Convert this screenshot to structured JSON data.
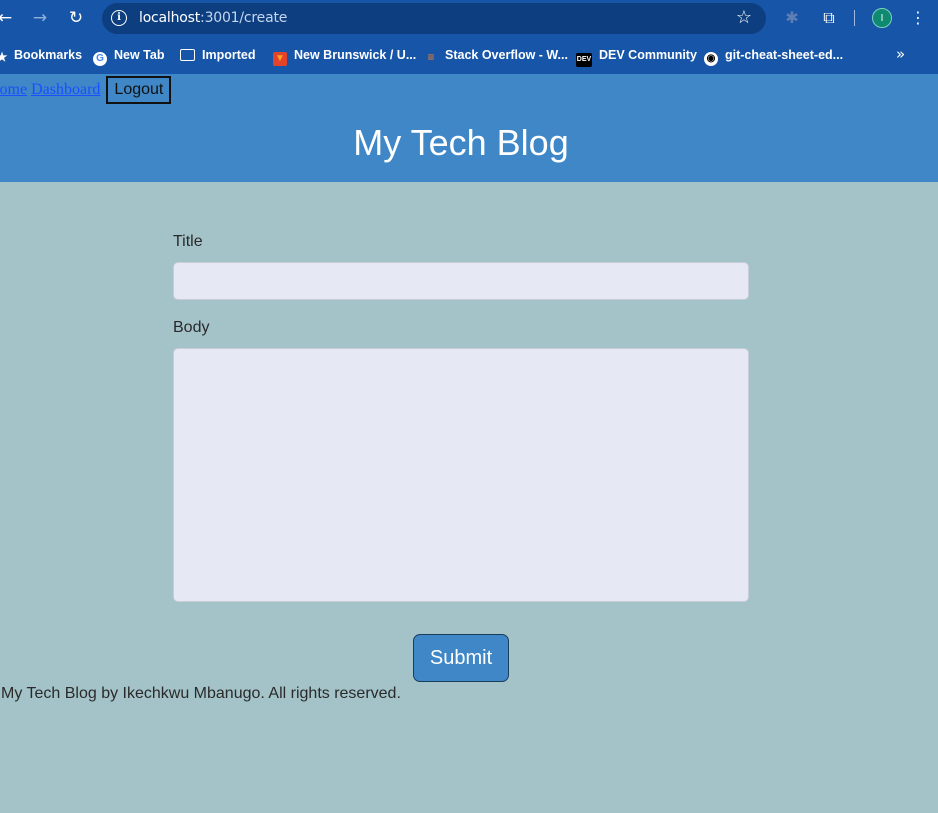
{
  "browser": {
    "url_host": "localhost",
    "url_rest": ":3001/create",
    "profile_initial": "I",
    "bookmarks": [
      {
        "label": "Bookmarks",
        "icon": "star-icon"
      },
      {
        "label": "New Tab",
        "icon": "google-icon"
      },
      {
        "label": "Imported",
        "icon": "folder-icon"
      },
      {
        "label": "New Brunswick / U...",
        "icon": "gitlab-icon"
      },
      {
        "label": "Stack Overflow - W...",
        "icon": "stackoverflow-icon"
      },
      {
        "label": "DEV Community",
        "icon": "dev-icon"
      },
      {
        "label": "git-cheat-sheet-ed...",
        "icon": "github-icon"
      }
    ]
  },
  "header": {
    "nav": {
      "home": "Home",
      "dashboard": "Dashboard",
      "logout": "Logout"
    },
    "title": "My Tech Blog"
  },
  "form": {
    "title_label": "Title",
    "title_value": "",
    "body_label": "Body",
    "body_value": "",
    "submit_label": "Submit"
  },
  "footer": {
    "text": "My Tech Blog by Ikechkwu Mbanugo. All rights reserved."
  },
  "colors": {
    "browser_chrome": "#1755a8",
    "header_bg": "#3f87c6",
    "page_bg": "#a3c3c8",
    "input_bg": "#e6e9f3",
    "link": "#1a4fff"
  }
}
